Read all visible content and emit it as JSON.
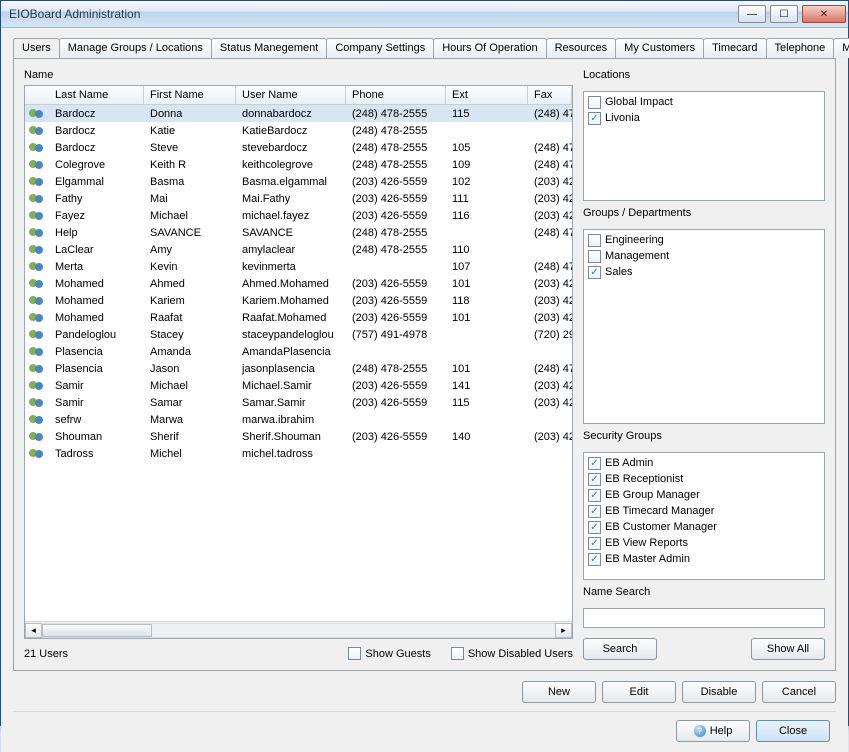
{
  "window": {
    "title": "EIOBoard Administration"
  },
  "tabs": [
    {
      "label": "Users"
    },
    {
      "label": "Manage Groups / Locations"
    },
    {
      "label": "Status Manegement"
    },
    {
      "label": "Company Settings"
    },
    {
      "label": "Hours Of Operation"
    },
    {
      "label": "Resources"
    },
    {
      "label": "My Customers"
    },
    {
      "label": "Timecard"
    },
    {
      "label": "Telephone"
    },
    {
      "label": "Marquee"
    }
  ],
  "active_tab": 0,
  "name_section_label": "Name",
  "columns": {
    "last": "Last Name",
    "first": "First Name",
    "user": "User Name",
    "phone": "Phone",
    "ext": "Ext",
    "fax": "Fax"
  },
  "rows": [
    {
      "last": "Bardocz",
      "first": "Donna",
      "user": "donnabardocz",
      "phone": "(248) 478-2555",
      "ext": "115",
      "fax": "(248) 47"
    },
    {
      "last": "Bardocz",
      "first": "Katie",
      "user": "KatieBardocz",
      "phone": "(248) 478-2555",
      "ext": "",
      "fax": ""
    },
    {
      "last": "Bardocz",
      "first": "Steve",
      "user": "stevebardocz",
      "phone": "(248) 478-2555",
      "ext": "105",
      "fax": "(248) 47"
    },
    {
      "last": "Colegrove",
      "first": "Keith R",
      "user": "keithcolegrove",
      "phone": "(248) 478-2555",
      "ext": "109",
      "fax": "(248) 47"
    },
    {
      "last": "Elgammal",
      "first": "Basma",
      "user": "Basma.elgammal",
      "phone": "(203) 426-5559",
      "ext": "102",
      "fax": "(203) 42"
    },
    {
      "last": "Fathy",
      "first": "Mai",
      "user": "Mai.Fathy",
      "phone": "(203) 426-5559",
      "ext": "111",
      "fax": "(203) 42"
    },
    {
      "last": "Fayez",
      "first": "Michael",
      "user": "michael.fayez",
      "phone": "(203) 426-5559",
      "ext": "116",
      "fax": "(203) 42"
    },
    {
      "last": "Help",
      "first": "SAVANCE",
      "user": "SAVANCE",
      "phone": "(248) 478-2555",
      "ext": "",
      "fax": "(248) 47"
    },
    {
      "last": "LaClear",
      "first": "Amy",
      "user": "amylaclear",
      "phone": "(248) 478-2555",
      "ext": "110",
      "fax": ""
    },
    {
      "last": "Merta",
      "first": "Kevin",
      "user": "kevinmerta",
      "phone": "",
      "ext": "107",
      "fax": "(248) 47"
    },
    {
      "last": "Mohamed",
      "first": "Ahmed",
      "user": "Ahmed.Mohamed",
      "phone": "(203) 426-5559",
      "ext": "101",
      "fax": "(203) 42"
    },
    {
      "last": "Mohamed",
      "first": "Kariem",
      "user": "Kariem.Mohamed",
      "phone": "(203) 426-5559",
      "ext": "118",
      "fax": "(203) 42"
    },
    {
      "last": "Mohamed",
      "first": "Raafat",
      "user": "Raafat.Mohamed",
      "phone": "(203) 426-5559",
      "ext": "101",
      "fax": "(203) 42"
    },
    {
      "last": "Pandeloglou",
      "first": "Stacey",
      "user": "staceypandeloglou",
      "phone": "(757) 491-4978",
      "ext": "",
      "fax": "(720) 29"
    },
    {
      "last": "Plasencia",
      "first": "Amanda",
      "user": "AmandaPlasencia",
      "phone": "",
      "ext": "",
      "fax": ""
    },
    {
      "last": "Plasencia",
      "first": "Jason",
      "user": "jasonplasencia",
      "phone": "(248) 478-2555",
      "ext": "101",
      "fax": "(248) 47"
    },
    {
      "last": "Samir",
      "first": "Michael",
      "user": "Michael.Samir",
      "phone": "(203) 426-5559",
      "ext": "141",
      "fax": "(203) 42"
    },
    {
      "last": "Samir",
      "first": "Samar",
      "user": "Samar.Samir",
      "phone": "(203) 426-5559",
      "ext": "115",
      "fax": "(203) 42"
    },
    {
      "last": "sefrw",
      "first": "Marwa",
      "user": "marwa.ibrahim",
      "phone": "",
      "ext": "",
      "fax": ""
    },
    {
      "last": "Shouman",
      "first": "Sherif",
      "user": "Sherif.Shouman",
      "phone": "(203) 426-5559",
      "ext": "140",
      "fax": "(203) 42"
    },
    {
      "last": "Tadross",
      "first": "Michel",
      "user": "michel.tadross",
      "phone": "",
      "ext": "",
      "fax": ""
    }
  ],
  "selected_row": 0,
  "user_count_label": "21 Users",
  "show_guests_label": "Show Guests",
  "show_disabled_label": "Show Disabled Users",
  "locations_label": "Locations",
  "locations": [
    {
      "label": "Global Impact",
      "checked": false
    },
    {
      "label": "Livonia",
      "checked": true
    }
  ],
  "groups_label": "Groups / Departments",
  "groups": [
    {
      "label": "Engineering",
      "checked": false
    },
    {
      "label": "Management",
      "checked": false
    },
    {
      "label": "Sales",
      "checked": true
    }
  ],
  "security_label": "Security Groups",
  "security": [
    {
      "label": "EB Admin",
      "checked": true
    },
    {
      "label": "EB Receptionist",
      "checked": true
    },
    {
      "label": "EB Group Manager",
      "checked": true
    },
    {
      "label": "EB Timecard Manager",
      "checked": true
    },
    {
      "label": "EB Customer Manager",
      "checked": true
    },
    {
      "label": "EB View Reports",
      "checked": true
    },
    {
      "label": "EB Master Admin",
      "checked": true
    }
  ],
  "name_search_label": "Name Search",
  "buttons": {
    "search": "Search",
    "show_all": "Show All",
    "new": "New",
    "edit": "Edit",
    "disable": "Disable",
    "cancel": "Cancel",
    "help": "Help",
    "close": "Close"
  }
}
